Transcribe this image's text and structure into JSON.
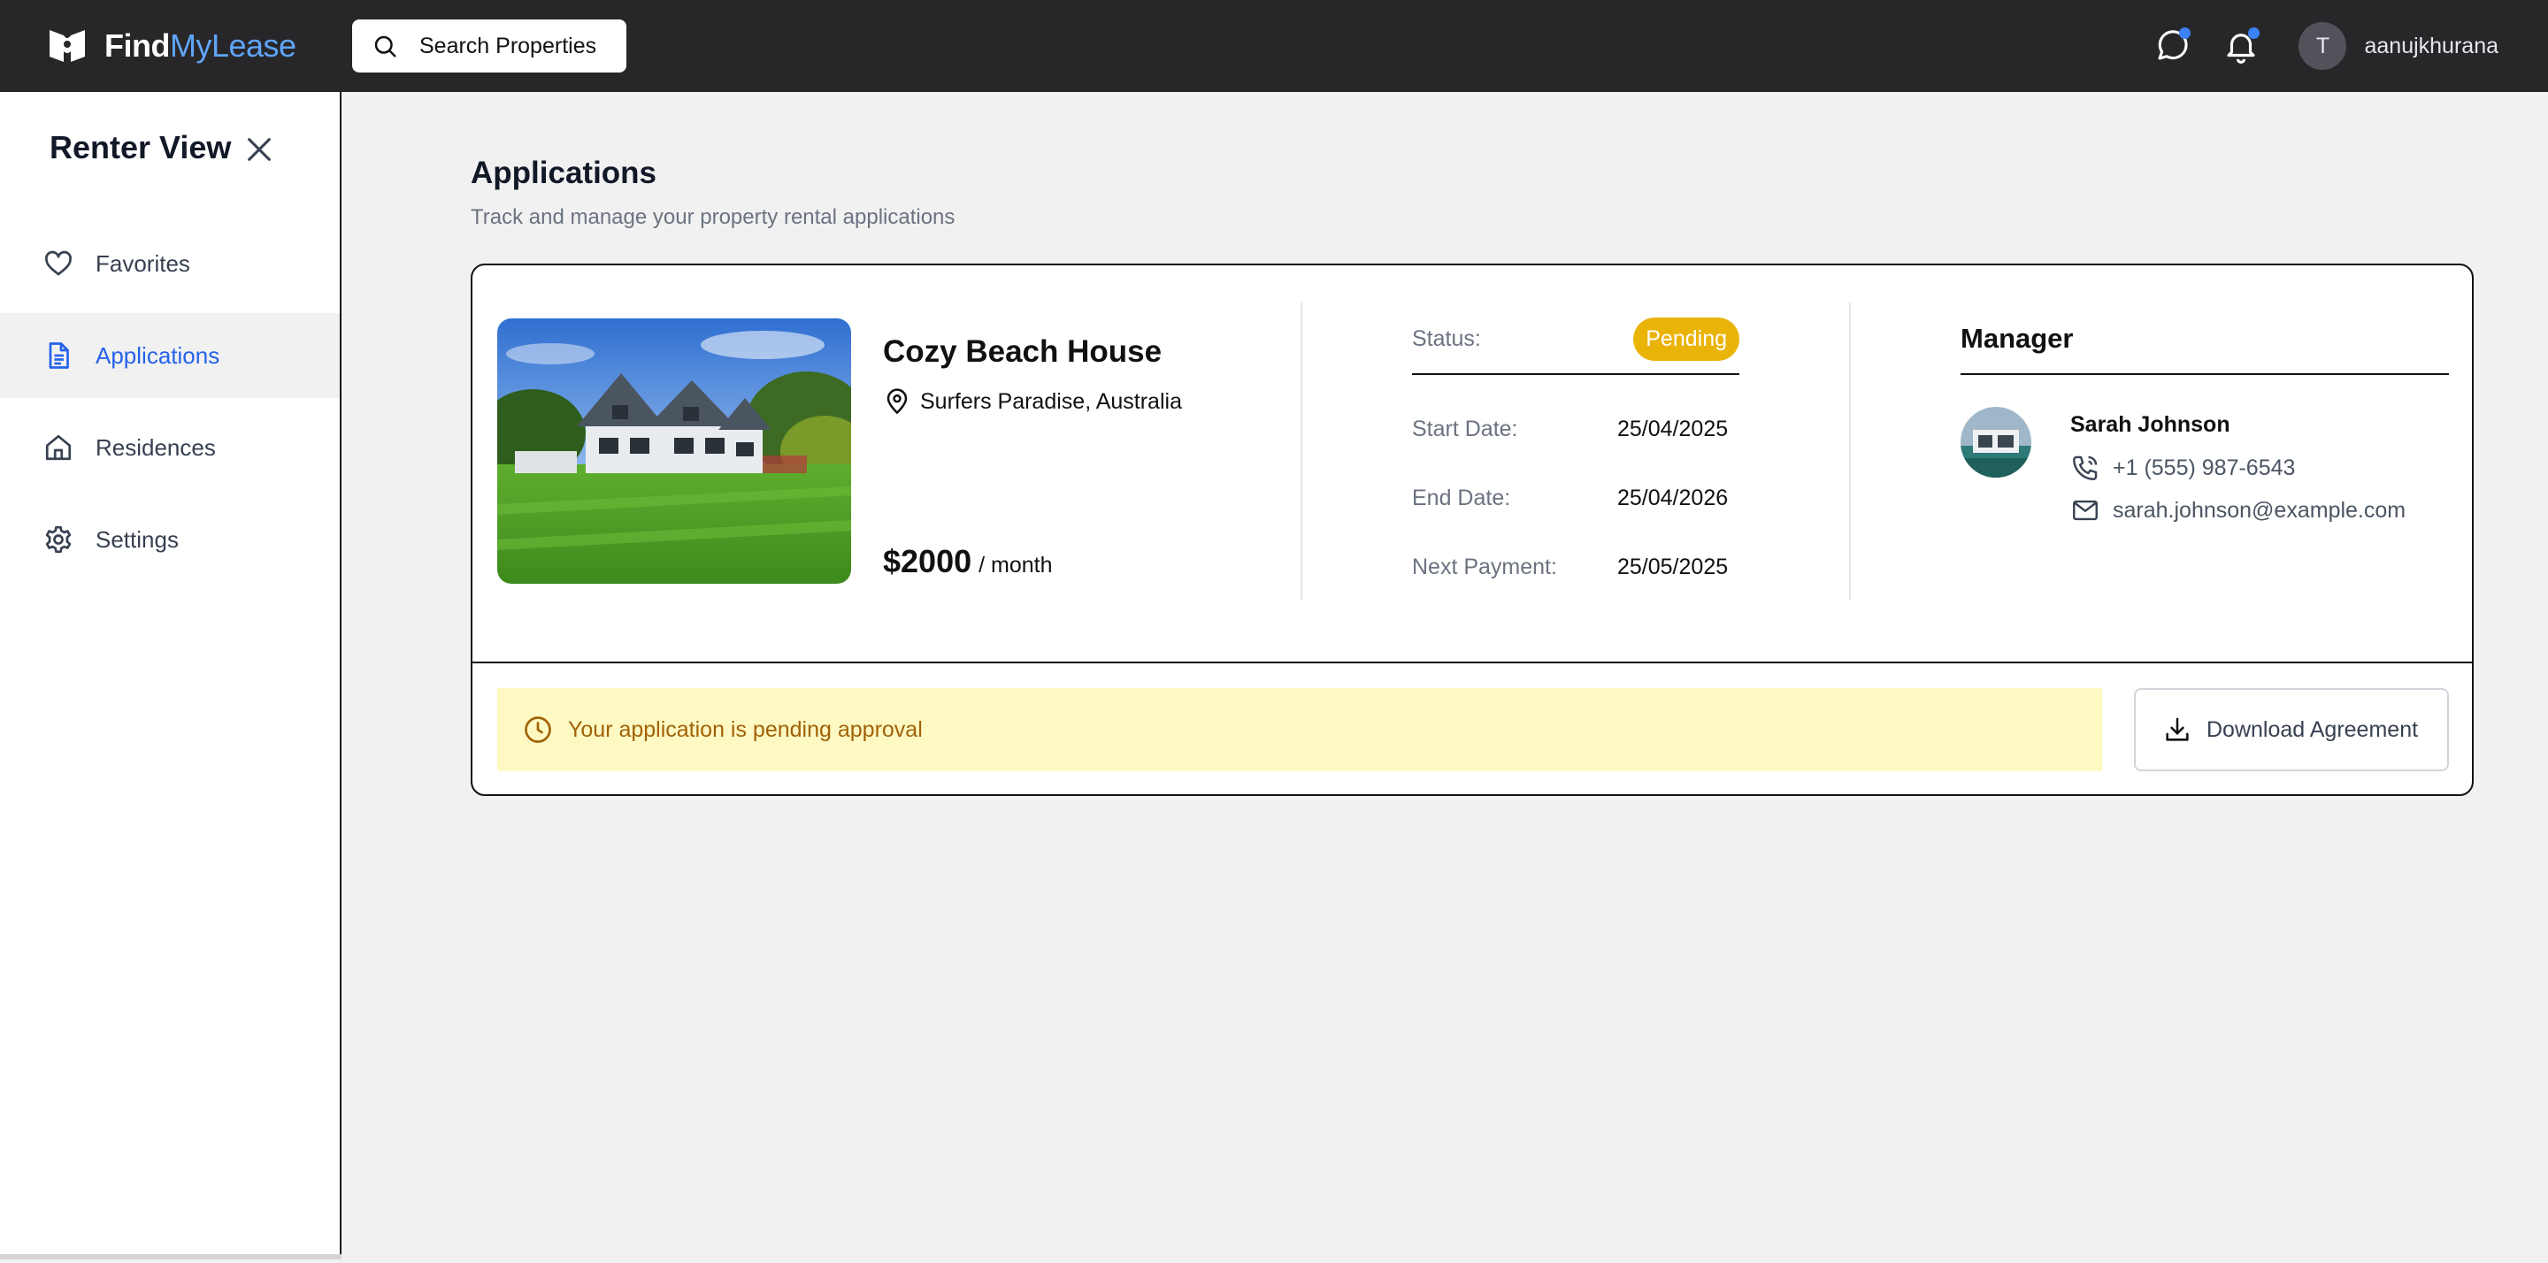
{
  "app": {
    "brand_main": "Find",
    "brand_accent": "MyLease",
    "search_label": "Search Properties",
    "avatar_initial": "T",
    "username": "aanujkhurana",
    "brand_accent_color": "#60a5fa",
    "notification_dot_color": "#3b82f6"
  },
  "sidebar": {
    "title": "Renter View",
    "items": [
      {
        "label": "Favorites",
        "icon": "heart-icon",
        "active": false
      },
      {
        "label": "Applications",
        "icon": "document-icon",
        "active": true
      },
      {
        "label": "Residences",
        "icon": "home-icon",
        "active": false
      },
      {
        "label": "Settings",
        "icon": "gear-icon",
        "active": false
      }
    ]
  },
  "page": {
    "title": "Applications",
    "subtitle": "Track and manage your property rental applications"
  },
  "application": {
    "property_name": "Cozy Beach House",
    "location": "Surfers Paradise, Australia",
    "price": "$2000",
    "price_period": "/ month",
    "status_label": "Status:",
    "status_value": "Pending",
    "status_color": "#eab308",
    "start_label": "Start Date:",
    "start_value": "25/04/2025",
    "end_label": "End Date:",
    "end_value": "25/04/2026",
    "next_label": "Next Payment:",
    "next_value": "25/05/2025",
    "manager_title": "Manager",
    "manager_name": "Sarah Johnson",
    "manager_phone": "+1 (555) 987-6543",
    "manager_email": "sarah.johnson@example.com",
    "pending_message": "Your application is pending approval",
    "download_label": "Download Agreement"
  }
}
